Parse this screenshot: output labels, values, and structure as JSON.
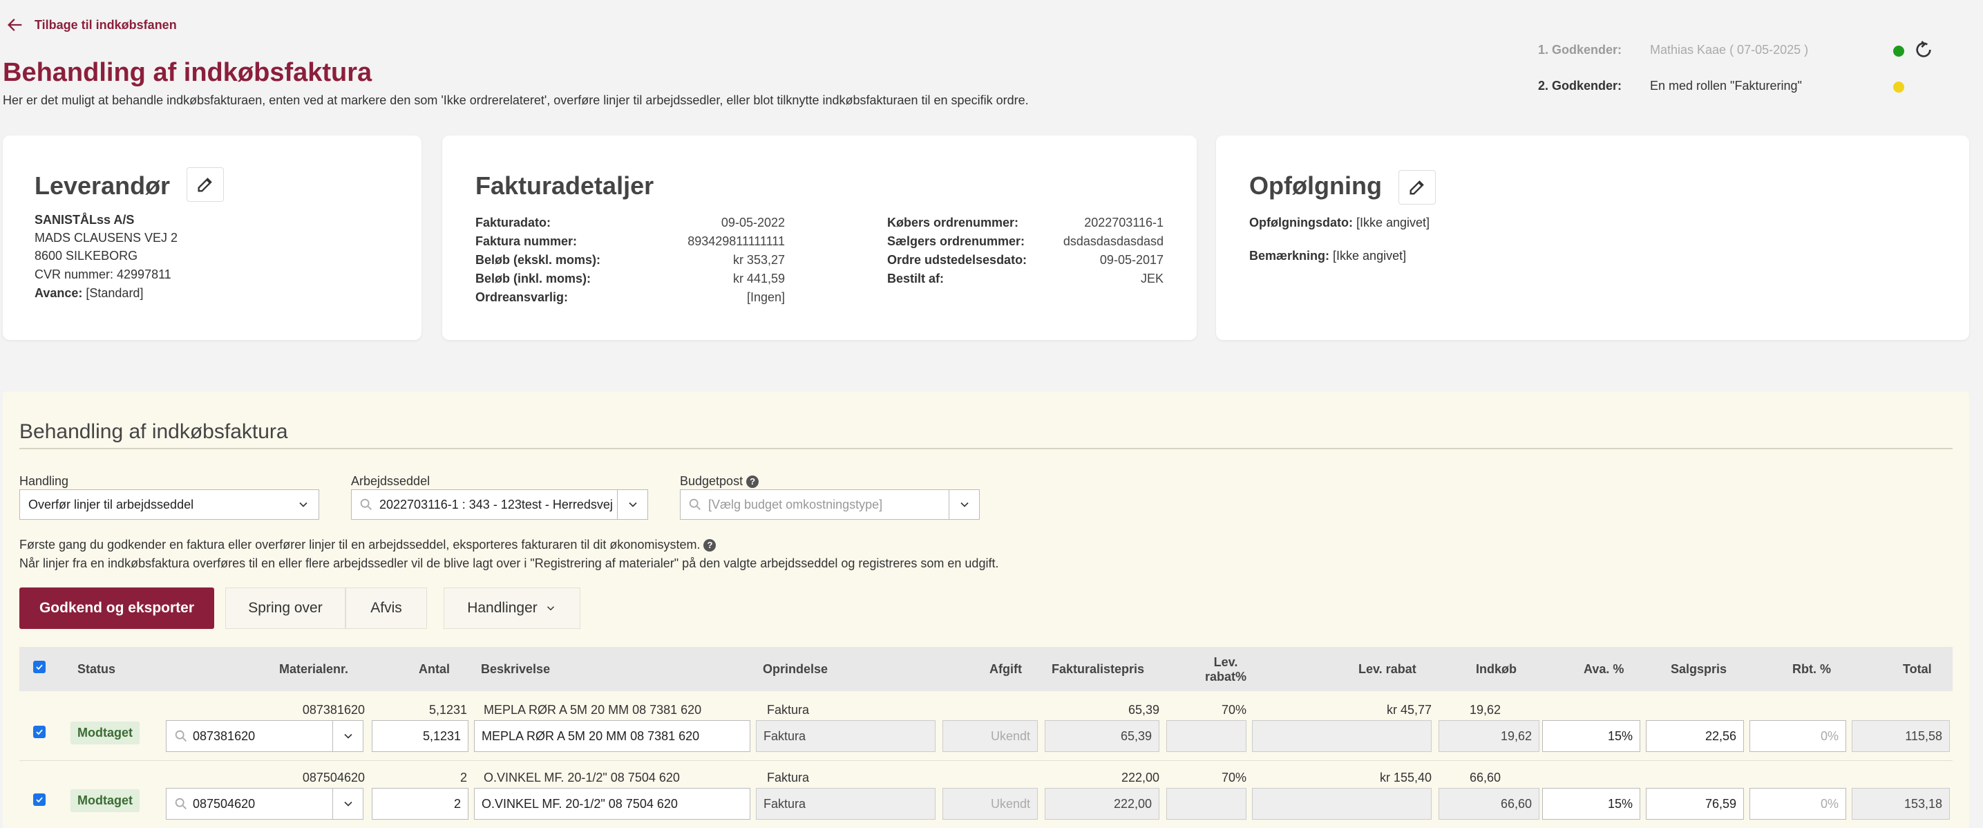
{
  "header": {
    "back_label": "Tilbage til indkøbsfanen",
    "title": "Behandling af indkøbsfaktura",
    "description": "Her er det muligt at behandle indkøbsfakturaen, enten ved at markere den som 'Ikke ordrerelateret', overføre linjer til arbejdssedler, eller blot tilknytte indkøbsfakturaen til en specifik ordre."
  },
  "approvers": [
    {
      "label": "1. Godkender:",
      "value": "Mathias Kaae ( 07-05-2025 )",
      "status_color": "#1e9c1e"
    },
    {
      "label": "2. Godkender:",
      "value": "En med rollen \"Fakturering\"",
      "status_color": "#f2d21b"
    }
  ],
  "supplier": {
    "title": "Leverandør",
    "name": "SANISTÅLss A/S",
    "address": "MADS CLAUSENS VEJ 2",
    "city": "8600 SILKEBORG",
    "cvr": "CVR nummer: 42997811",
    "avance_label": "Avance:",
    "avance_value": "[Standard]"
  },
  "invoice": {
    "title": "Fakturadetaljer",
    "left": [
      {
        "k": "Fakturadato:",
        "v": "09-05-2022"
      },
      {
        "k": "Faktura nummer:",
        "v": "893429811111111"
      },
      {
        "k": "Beløb (ekskl. moms):",
        "v": "kr 353,27"
      },
      {
        "k": "Beløb (inkl. moms):",
        "v": "kr 441,59"
      },
      {
        "k": "Ordreansvarlig:",
        "v": "[Ingen]"
      }
    ],
    "right": [
      {
        "k": "Købers ordrenummer:",
        "v": "2022703116-1"
      },
      {
        "k": "Sælgers ordrenummer:",
        "v": "dsdasdasdasdasd"
      },
      {
        "k": "Ordre udstedelsesdato:",
        "v": "09-05-2017"
      },
      {
        "k": "Bestilt af:",
        "v": "JEK"
      }
    ]
  },
  "followup": {
    "title": "Opfølgning",
    "date_label": "Opfølgningsdato:",
    "date_value": "[Ikke angivet]",
    "note_label": "Bemærkning:",
    "note_value": "[Ikke angivet]"
  },
  "processing": {
    "title": "Behandling af indkøbsfaktura",
    "action_label": "Handling",
    "action_value": "Overfør linjer til arbejdsseddel",
    "worksheet_label": "Arbejdsseddel",
    "worksheet_value": "2022703116-1 : 343 - 123test - Herredsvej",
    "budget_label": "Budgetpost",
    "budget_placeholder": "[Vælg budget omkostningstype]",
    "info1": "Første gang du godkender en faktura eller overfører linjer til en arbejdsseddel, eksporteres fakturaren til dit økonomisystem.",
    "info2": "Når linjer fra en indkøbsfaktura overføres til en eller flere arbejdssedler vil de blive lagt over i \"Registrering af materialer\" på den valgte arbejdsseddel og registreres som en udgift.",
    "buttons": {
      "approve": "Godkend og eksporter",
      "skip": "Spring over",
      "reject": "Afvis",
      "actions": "Handlinger"
    }
  },
  "table": {
    "columns": {
      "status": "Status",
      "material": "Materialenr.",
      "qty": "Antal",
      "desc": "Beskrivelse",
      "origin": "Oprindelse",
      "fee": "Afgift",
      "listprice": "Fakturalistepris",
      "supdisc_pct_1": "Lev.",
      "supdisc_pct_2": "rabat%",
      "supdisc": "Lev. rabat",
      "purchase": "Indkøb",
      "markup": "Ava. %",
      "saleprice": "Salgspris",
      "discount": "Rbt. %",
      "total": "Total"
    },
    "rows": [
      {
        "ref_material": "087381620",
        "ref_qty": "5,1231",
        "ref_desc": "MEPLA RØR A 5M 20 MM 08 7381 620",
        "ref_origin": "Faktura",
        "ref_listprice": "65,39",
        "ref_supdisc_pct": "70%",
        "ref_supdisc": "kr 45,77",
        "ref_purchase": "19,62",
        "status": "Modtaget",
        "material": "087381620",
        "qty": "5,1231",
        "desc": "MEPLA RØR A 5M  20 MM  08 7381 620",
        "origin": "Faktura",
        "fee": "Ukendt",
        "listprice": "65,39",
        "purchase": "19,62",
        "markup": "15%",
        "saleprice": "22,56",
        "discount": "0%",
        "total": "115,58"
      },
      {
        "ref_material": "087504620",
        "ref_qty": "2",
        "ref_desc": "O.VINKEL MF. 20-1/2\" 08 7504 620",
        "ref_origin": "Faktura",
        "ref_listprice": "222,00",
        "ref_supdisc_pct": "70%",
        "ref_supdisc": "kr 155,40",
        "ref_purchase": "66,60",
        "status": "Modtaget",
        "material": "087504620",
        "qty": "2",
        "desc": "O.VINKEL MF.   20-1/2\" 08 7504 620",
        "origin": "Faktura",
        "fee": "Ukendt",
        "listprice": "222,00",
        "purchase": "66,60",
        "markup": "15%",
        "saleprice": "76,59",
        "discount": "0%",
        "total": "153,18"
      }
    ]
  }
}
